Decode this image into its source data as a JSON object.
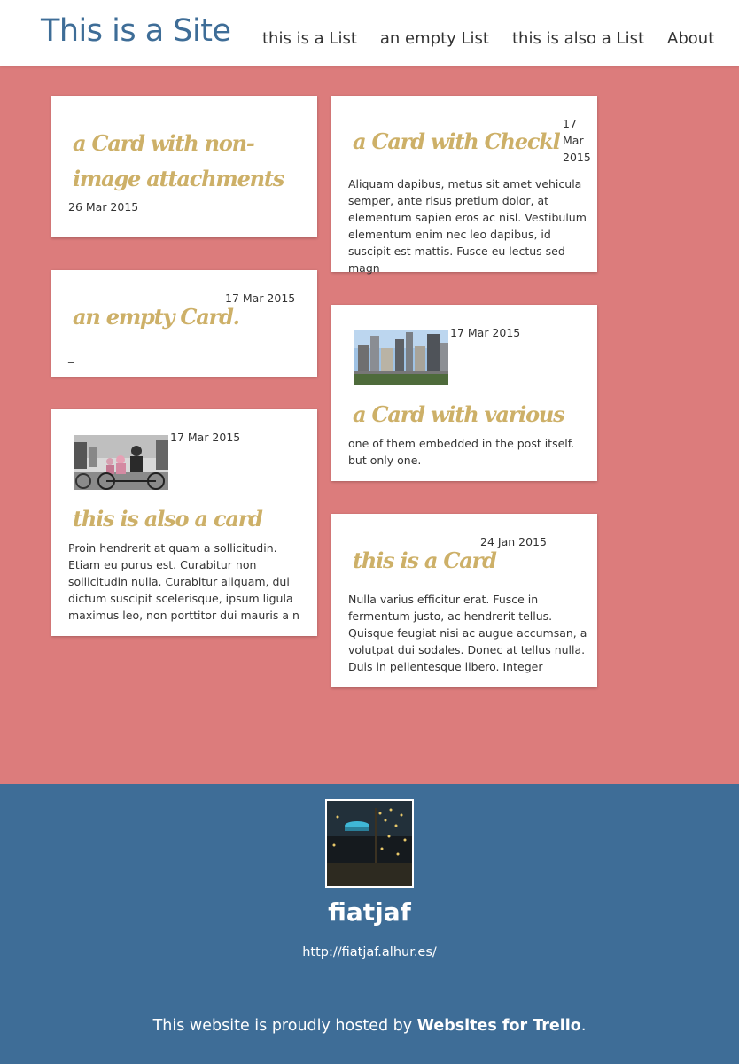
{
  "header": {
    "site_title": "This is a Site",
    "nav": [
      {
        "label": "this is a List"
      },
      {
        "label": "an empty List"
      },
      {
        "label": "this is also a List"
      },
      {
        "label": "About"
      }
    ]
  },
  "cards": {
    "c1": {
      "title": "a Card with non-image attachments",
      "date": "26 Mar 2015"
    },
    "c2": {
      "title": "an empty Card.",
      "date": "17 Mar 2015",
      "text": "_"
    },
    "c3": {
      "title": "this is also a card",
      "date": "17 Mar 2015",
      "text": "Proin hendrerit at quam a sollicitudin. Etiam eu purus est. Curabitur non sollicitudin nulla. Curabitur aliquam, dui dictum suscipit scelerisque, ipsum ligula maximus leo, non porttitor dui mauris a n"
    },
    "c4": {
      "title": "a Card with Checklists",
      "date": "17 Mar 2015",
      "text": "Aliquam dapibus, metus sit amet vehicula semper, ante risus pretium dolor, at elementum sapien eros ac nisl. Vestibulum elementum enim nec leo dapibus, id suscipit est mattis. Fusce eu lectus sed magn"
    },
    "c5": {
      "title": "a Card with various",
      "date": "17 Mar 2015",
      "text": "one of them embedded in the post itself. but only one."
    },
    "c6": {
      "title": "this is a Card",
      "date": "24 Jan 2015",
      "text": "Nulla varius efficitur erat. Fusce in fermentum justo, ac hendrerit tellus. Quisque feugiat nisi ac augue accumsan, a volutpat dui sodales. Donec at tellus nulla. Duis in pellentesque libero. Integer"
    }
  },
  "footer": {
    "name": "fiatjaf",
    "url": "http://fiatjaf.alhur.es/",
    "hosted_prefix": "This website is proudly hosted by ",
    "hosted_link": "Websites for Trello",
    "hosted_suffix": "."
  },
  "colors": {
    "background": "#dc7c7c",
    "brand": "#3e6d97",
    "card_title": "#cdb068"
  }
}
